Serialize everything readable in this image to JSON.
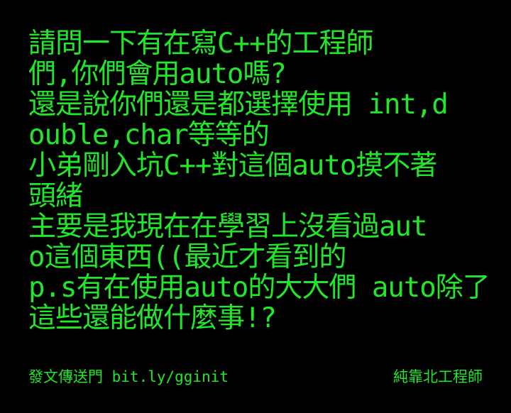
{
  "post": {
    "lines": [
      "請問一下有在寫C++的工程師",
      "們,你們會用auto嗎?",
      "還是說你們還是都選擇使用 int,d",
      "ouble,char等等的",
      "小弟剛入坑C++對這個auto摸不著",
      "頭緒",
      "主要是我現在在學習上沒看過aut",
      "o這個東西((最近才看到的",
      "p.s有在使用auto的大大們 auto除了",
      "這些還能做什麼事!?"
    ]
  },
  "footer": {
    "link_text": "發文傳送門 bit.ly/gginit",
    "brand": "純靠北工程師"
  },
  "colors": {
    "background": "#000000",
    "text": "#22e62a"
  }
}
